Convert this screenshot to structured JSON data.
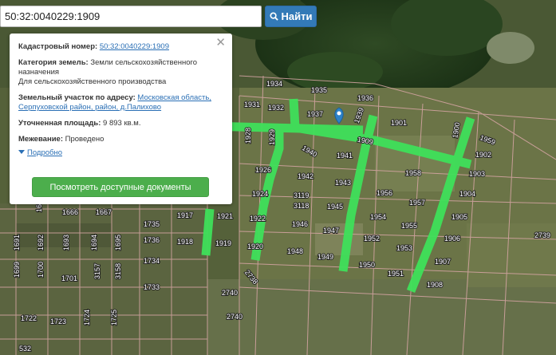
{
  "search": {
    "value": "50:32:0040229:1909",
    "button_label": "Найти",
    "button_icon": "search-icon"
  },
  "popup": {
    "cadastral_label": "Кадастровый номер:",
    "cadastral_value": "50:32:0040229:1909",
    "category_label": "Категория земель:",
    "category_value": "Земли сельскохозяйственного назначения",
    "category_use": "Для сельскохозяйственного производства",
    "address_label": "Земельный участок по адресу:",
    "address_value": "Московская область, Серпуховской район, район, д.Палихово",
    "area_label": "Уточненная площадь:",
    "area_value": "9 893 кв.м.",
    "survey_label": "Межевание:",
    "survey_value": "Проведено",
    "details_label": "Подробно",
    "docs_button": "Посмотреть доступные документы",
    "close_icon": "close-icon"
  },
  "colors": {
    "road": "#3fe05a",
    "parcel_line": "#d8a6a6",
    "search_button": "#337ab7",
    "docs_button": "#4cae4c",
    "marker": "#2c82c9"
  },
  "map_labels": [
    "1934",
    "1935",
    "1936",
    "1931",
    "1932",
    "1937",
    "1939",
    "1901",
    "1900",
    "1928",
    "1929",
    "1941",
    "1940",
    "1902",
    "1959",
    "1903",
    "1958",
    "1926",
    "1942",
    "1943",
    "1904",
    "1924",
    "3119",
    "1956",
    "1957",
    "1905",
    "3118",
    "1945",
    "1954",
    "1955",
    "1946",
    "1947",
    "1952",
    "1953",
    "1906",
    "2739",
    "1921",
    "1922",
    "1919",
    "1920",
    "1948",
    "1949",
    "1950",
    "1951",
    "1907",
    "1908",
    "1917",
    "1918",
    "1735",
    "1736",
    "1734",
    "1733",
    "2738",
    "2740",
    "1666",
    "1667",
    "1665",
    "1691",
    "1692",
    "1693",
    "1694",
    "1695",
    "1699",
    "1700",
    "1701",
    "3157",
    "3158",
    "1722",
    "1723",
    "1724",
    "1725",
    "2740",
    "532",
    "1909"
  ]
}
